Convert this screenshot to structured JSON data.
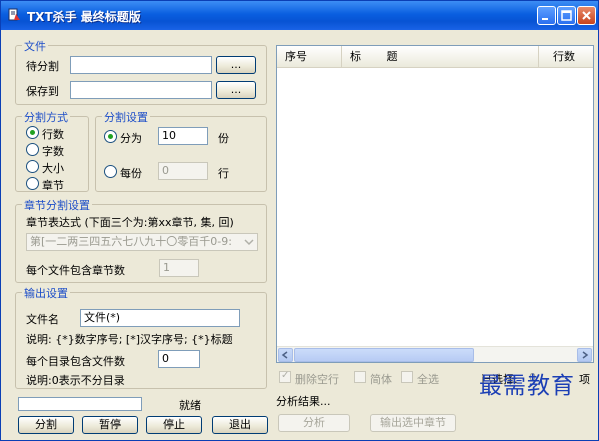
{
  "window": {
    "title": "TXT杀手 最终标题版"
  },
  "file_group": {
    "title": "文件",
    "split_label": "待分割",
    "save_label": "保存到",
    "browse_label": "...",
    "split_value": "",
    "save_value": ""
  },
  "split_mode": {
    "title": "分割方式",
    "options": [
      "行数",
      "字数",
      "大小",
      "章节"
    ],
    "selected": "行数"
  },
  "split_settings": {
    "title": "分割设置",
    "into_label": "分为",
    "into_value": "10",
    "into_unit": "份",
    "each_label": "每份",
    "each_value": "0",
    "each_unit": "行",
    "selected": "分为"
  },
  "chapter_settings": {
    "title": "章节分割设置",
    "expr_label": "章节表达式 (下面三个为:第xx章节, 集, 回)",
    "expr_value": "第[一二两三四五六七八九十〇零百千0-9:",
    "count_label": "每个文件包含章节数",
    "count_value": "1"
  },
  "output_settings": {
    "title": "输出设置",
    "filename_label": "文件名",
    "filename_value": "文件(*)",
    "note1": "说明: {*}数字序号; [*]汉字序号; {*}标题",
    "per_dir_label": "每个目录包含文件数",
    "per_dir_value": "0",
    "note2": "说明:0表示不分目录"
  },
  "status": {
    "text": "就绪",
    "progress": 0
  },
  "bottom_buttons": {
    "split": "分割",
    "pause": "暂停",
    "stop": "停止",
    "exit": "退出"
  },
  "results": {
    "columns": [
      "序号",
      "标",
      "题",
      "行数"
    ],
    "rows": [],
    "remove_empty_label": "删除空行",
    "remove_empty_checked": true,
    "simplified_label": "简体",
    "simplified_checked": false,
    "select_all_label": "全选",
    "select_all_checked": false,
    "selected_label": "已选择:",
    "selected_count": "0",
    "selected_unit": "项",
    "analysis_label": "分析结果...",
    "analyze_button": "分析",
    "output_selected_button": "输出选中章节"
  },
  "watermark": "最需教育",
  "colors": {
    "title_bar": "#0a5fe0",
    "group_title": "#1c4dc8",
    "radio_dot": "#21a121"
  }
}
